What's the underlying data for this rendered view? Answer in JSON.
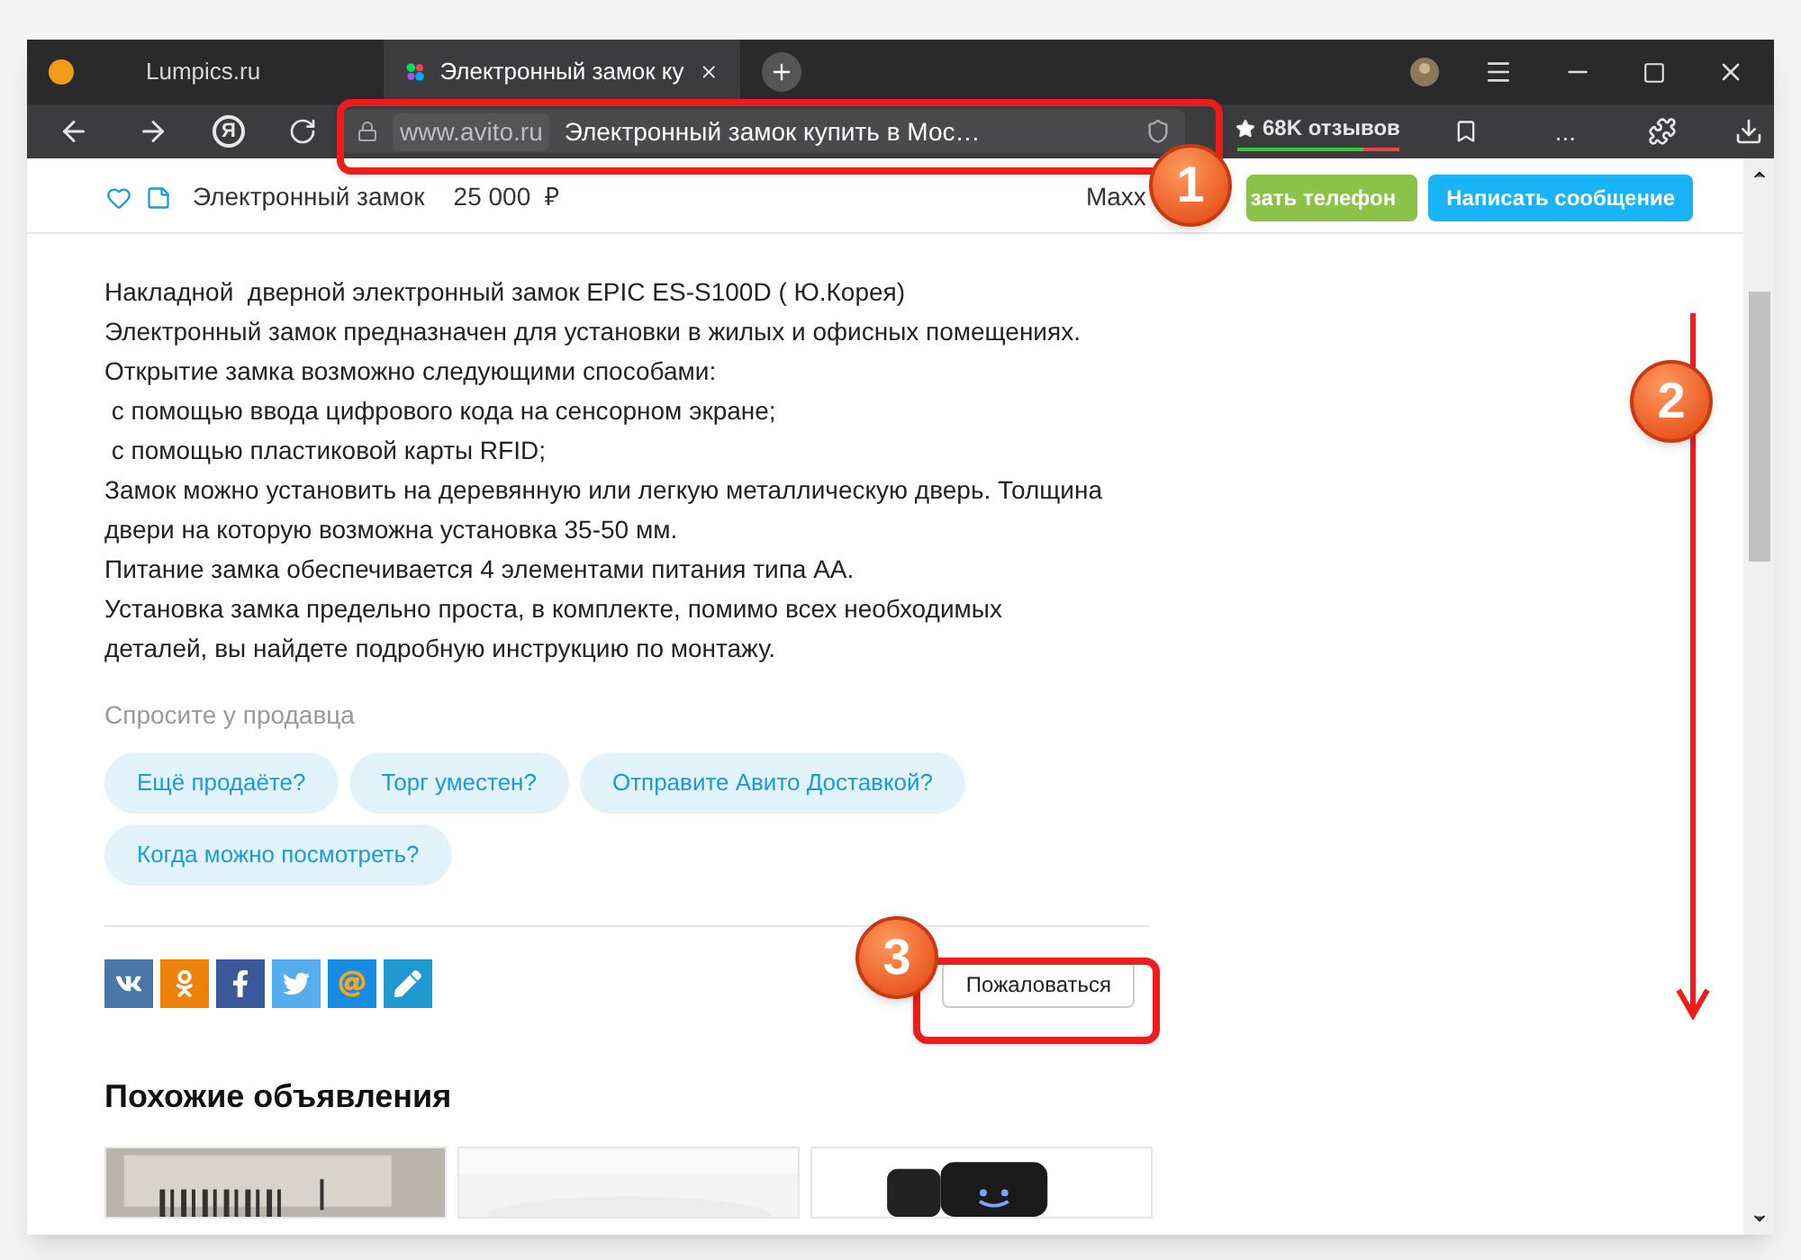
{
  "tabs": [
    {
      "title": "Lumpics.ru",
      "selected": false
    },
    {
      "title": "Электронный замок ку",
      "selected": true
    }
  ],
  "toolbar": {
    "home_glyph": "Я",
    "url_host": "www.avito.ru",
    "url_title": "Электронный замок купить в Мос…",
    "reviews": "68K отзывов",
    "reviews_bar": {
      "level": 0.78
    },
    "more": "..."
  },
  "sticky_header": {
    "title": "Электронный замок",
    "price": "25 000",
    "currency": "₽",
    "seller": "Maxx",
    "phone_button": "зать телефон",
    "message_button": "Написать сообщение"
  },
  "description": [
    "Накладной  дверной электронный замок EPIC ES-S100D ( Ю.Корея)",
    "Электронный замок предназначен для установки в жилых и офисных помещениях.",
    "Открытие замка возможно следующими способами:",
    " с помощью ввода цифрового кода на сенсорном экране;",
    " с помощью пластиковой карты RFID;",
    "Замок можно установить на деревянную или легкую металлическую дверь. Толщина",
    "двери на которую возможна установка 35-50 мм.",
    "Питание замка обеспечивается 4 элементами питания типа АА.",
    "Установка замка предельно проста, в комплекте, помимо всех необходимых",
    "деталей, вы найдете подробную инструкцию по монтажу."
  ],
  "ask_seller": {
    "label": "Спросите у продавца",
    "questions": [
      "Ещё продаёте?",
      "Торг уместен?",
      "Отправите Авито Доставкой?",
      "Когда можно посмотреть?"
    ]
  },
  "share": [
    {
      "kind": "vk",
      "color": "#4a76a8"
    },
    {
      "kind": "ok",
      "color": "#ee8208"
    },
    {
      "kind": "facebook",
      "color": "#3b5998"
    },
    {
      "kind": "twitter",
      "color": "#55acee"
    },
    {
      "kind": "mail",
      "color": "#168de2"
    },
    {
      "kind": "lj",
      "color": "#1d9bd1"
    }
  ],
  "report_button": "Пожаловаться",
  "similar": {
    "heading": "Похожие объявления"
  },
  "annotations": [
    {
      "number": "1"
    },
    {
      "number": "2"
    },
    {
      "number": "3"
    }
  ]
}
